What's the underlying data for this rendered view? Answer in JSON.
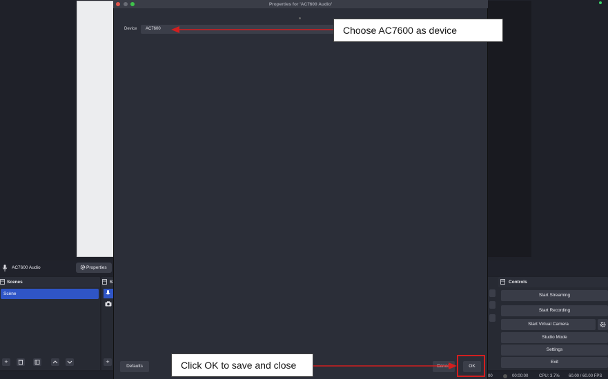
{
  "dialog": {
    "title": "Properties for 'AC7600 Audio'",
    "device_label": "Device",
    "device_value": "AC7600",
    "defaults_label": "Defaults",
    "cancel_label": "Cancel",
    "ok_label": "OK"
  },
  "source_bar": {
    "source_name": "AC7600 Audio",
    "properties_label": "Properties"
  },
  "scenes": {
    "title": "Scenes",
    "items": [
      "Scène"
    ]
  },
  "sources": {
    "title_fragment": "S"
  },
  "controls": {
    "title": "Controls",
    "buttons": [
      "Start Streaming",
      "Start Recording",
      "Start Virtual Camera",
      "Studio Mode",
      "Settings",
      "Exit"
    ]
  },
  "status": {
    "time_fragment": "00",
    "rec_time": "00:00:00",
    "cpu": "CPU: 3.7%",
    "fps": "60.00 / 60.00 FPS"
  },
  "annotations": {
    "device_callout": "Choose AC7600 as device",
    "ok_callout": "Click OK to save and close",
    "arrow_color": "#d21f1f"
  },
  "colors": {
    "accent": "#2f55c6",
    "background": "#1f2129",
    "dialog": "#2b2e38"
  }
}
